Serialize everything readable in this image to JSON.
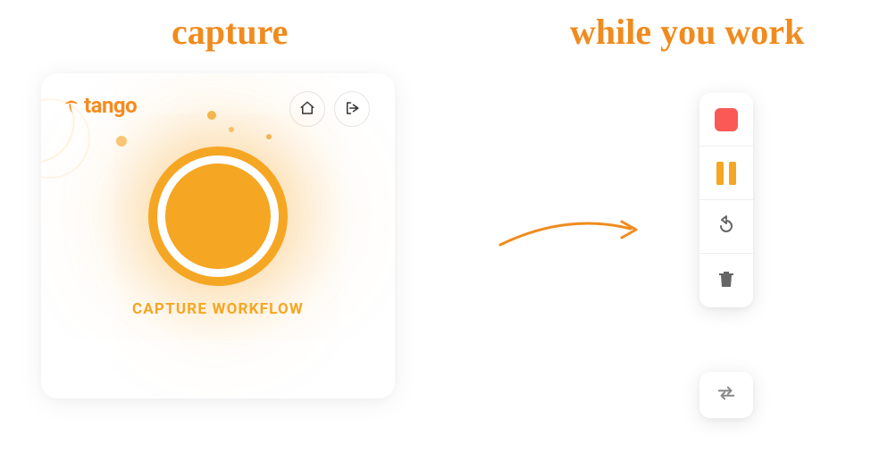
{
  "headings": {
    "left": "capture",
    "right": "while you work"
  },
  "capture_card": {
    "logo_text": "tango",
    "capture_label": "CAPTURE WORKFLOW",
    "icons": {
      "home": "home-icon",
      "exit": "exit-icon"
    }
  },
  "toolbar": {
    "items": [
      {
        "name": "stop"
      },
      {
        "name": "pause"
      },
      {
        "name": "undo"
      },
      {
        "name": "delete"
      }
    ],
    "swap": {
      "name": "swap"
    }
  },
  "colors": {
    "accent": "#f5a623",
    "accent_text": "#f08b1e",
    "stop": "#fa5a55"
  }
}
